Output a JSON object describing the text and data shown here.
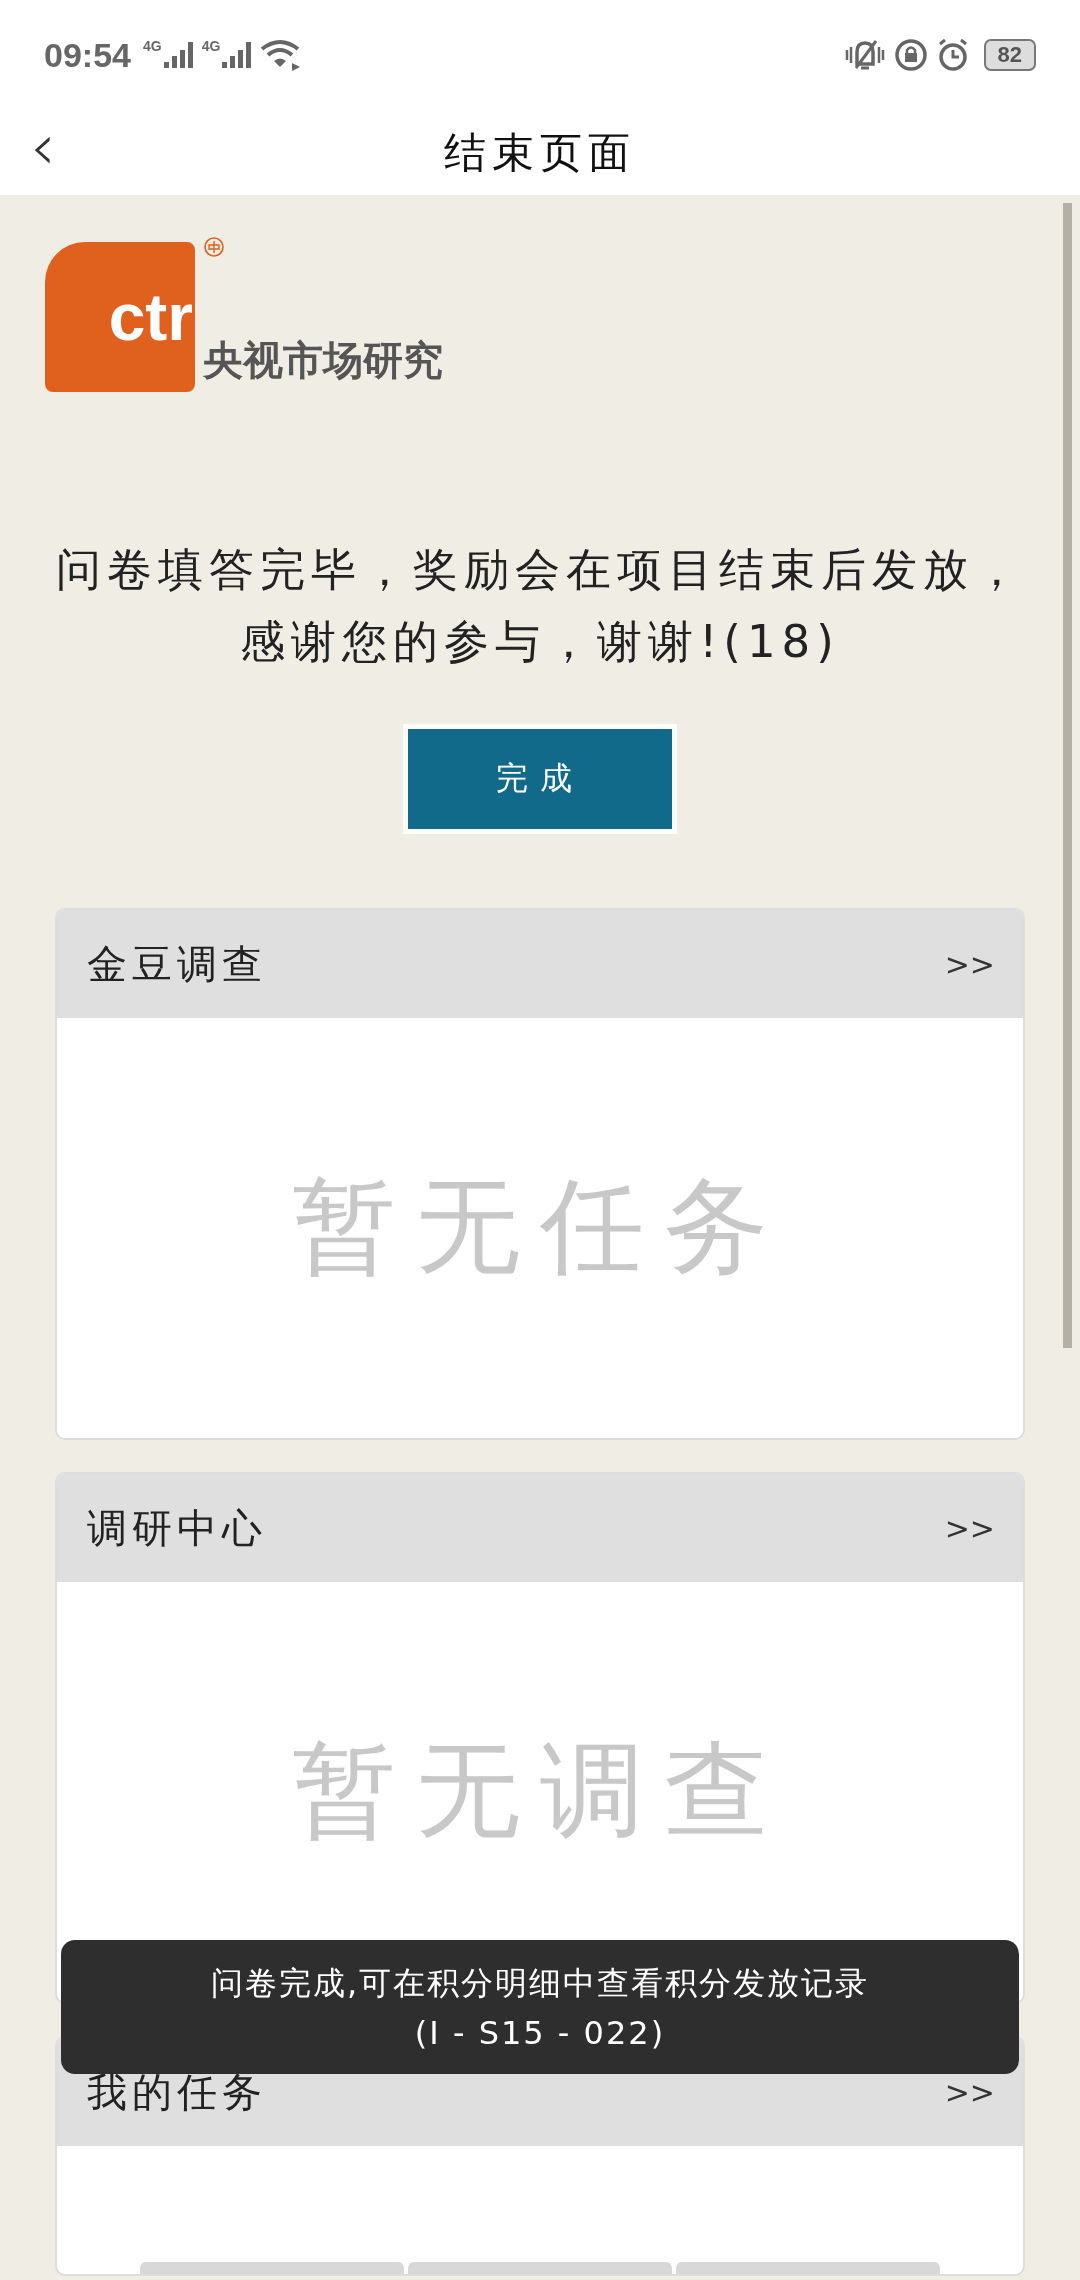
{
  "status_bar": {
    "time": "09:54",
    "signals": [
      {
        "label": "4G"
      },
      {
        "label": "4G"
      }
    ],
    "battery": "82"
  },
  "header": {
    "back": "‹",
    "title": "结束页面"
  },
  "logo": {
    "mark": "ctr",
    "name": "央视市场研究"
  },
  "message": "问卷填答完毕，奖励会在项目结束后发放，感谢您的参与，谢谢!(18)",
  "done_button": "完成",
  "cards": [
    {
      "title": "金豆调查",
      "more": ">>",
      "empty_text": "暂无任务"
    },
    {
      "title": "调研中心",
      "more": ">>",
      "empty_text": "暂无调查"
    },
    {
      "title": "我的任务",
      "more": ">>"
    }
  ],
  "toast": {
    "message": "问卷完成,可在积分明细中查看积分发放记录",
    "code": "(I - S15 - 022)"
  }
}
